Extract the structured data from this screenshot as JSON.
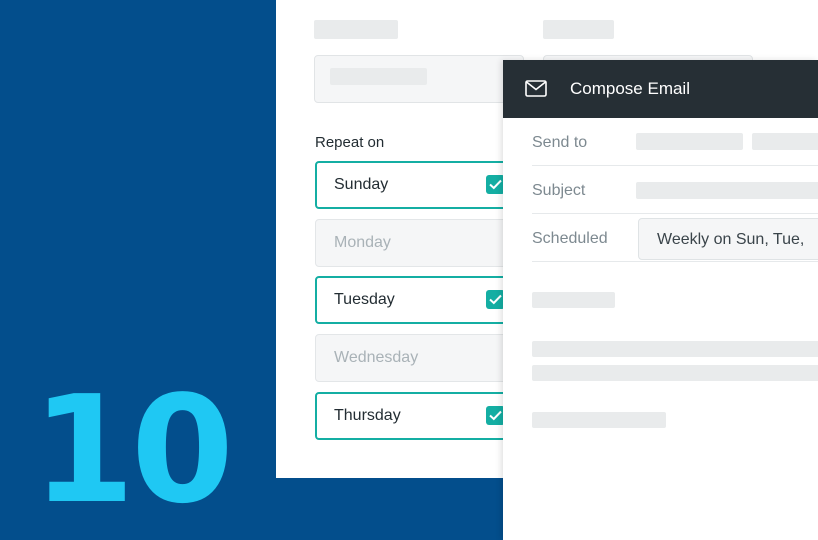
{
  "badge": {
    "number": "10"
  },
  "form": {
    "repeat_label": "Repeat on",
    "days": [
      {
        "label": "Sunday",
        "checked": true
      },
      {
        "label": "Monday",
        "checked": false
      },
      {
        "label": "Tuesday",
        "checked": true
      },
      {
        "label": "Wednesday",
        "checked": false
      },
      {
        "label": "Thursday",
        "checked": true
      }
    ]
  },
  "compose": {
    "title": "Compose Email",
    "send_to_label": "Send to",
    "subject_label": "Subject",
    "scheduled_label": "Scheduled",
    "scheduled_value": "Weekly on Sun, Tue,"
  },
  "colors": {
    "background": "#034e8c",
    "number": "#1fc8f3",
    "accent_teal": "#14aea3",
    "header_dark": "#262f35"
  },
  "icons": {
    "calendar": "calendar-icon",
    "mail": "mail-icon",
    "check": "checkmark-icon"
  }
}
